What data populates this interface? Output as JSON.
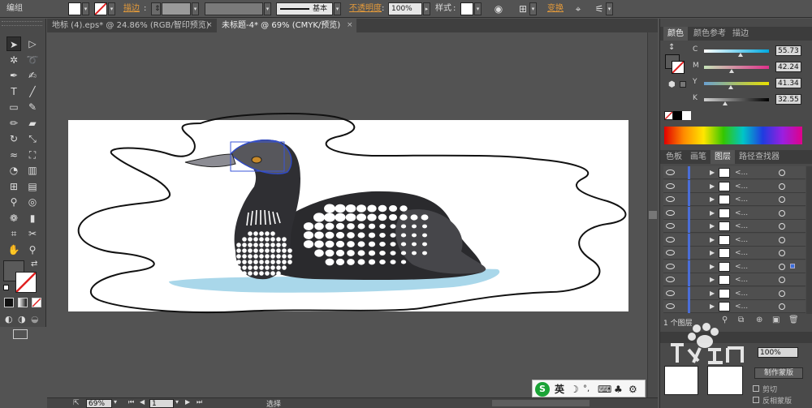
{
  "control_bar": {
    "mode_label": "编组",
    "stroke_label": "描边",
    "stroke_style": "基本",
    "opacity_label": "不透明度",
    "opacity_value": "100%",
    "style_label": "样式",
    "transform_label": "变换"
  },
  "tabs": [
    {
      "label": "地标 (4).eps* @ 24.86% (RGB/智印预览)",
      "close": "×"
    },
    {
      "label": "未标题-4* @ 69% (CMYK/预览)",
      "close": "×"
    }
  ],
  "tools": [
    {
      "icon": "selection-arrow-icon",
      "glyph": "➤"
    },
    {
      "icon": "direct-select-icon",
      "glyph": "▷"
    },
    {
      "icon": "magic-wand-icon",
      "glyph": "✲"
    },
    {
      "icon": "lasso-icon",
      "glyph": "➰"
    },
    {
      "icon": "pen-icon",
      "glyph": "✒"
    },
    {
      "icon": "curvature-icon",
      "glyph": "✍"
    },
    {
      "icon": "type-icon",
      "glyph": "T"
    },
    {
      "icon": "line-icon",
      "glyph": "╱"
    },
    {
      "icon": "rectangle-icon",
      "glyph": "▭"
    },
    {
      "icon": "paintbrush-icon",
      "glyph": "✎"
    },
    {
      "icon": "pencil-icon",
      "glyph": "✏"
    },
    {
      "icon": "eraser-icon",
      "glyph": "▰"
    },
    {
      "icon": "rotate-icon",
      "glyph": "↻"
    },
    {
      "icon": "scale-icon",
      "glyph": "⤡"
    },
    {
      "icon": "warp-icon",
      "glyph": "≈"
    },
    {
      "icon": "free-transform-icon",
      "glyph": "⛶"
    },
    {
      "icon": "shape-builder-icon",
      "glyph": "◔"
    },
    {
      "icon": "graph-icon",
      "glyph": "▥"
    },
    {
      "icon": "mesh-icon",
      "glyph": "⊞"
    },
    {
      "icon": "gradient-icon",
      "glyph": "▤"
    },
    {
      "icon": "eyedropper-icon",
      "glyph": "⚲"
    },
    {
      "icon": "blend-icon",
      "glyph": "◎"
    },
    {
      "icon": "symbol-sprayer-icon",
      "glyph": "❁"
    },
    {
      "icon": "column-graph-icon",
      "glyph": "▮"
    },
    {
      "icon": "artboard-icon",
      "glyph": "⌗"
    },
    {
      "icon": "slice-icon",
      "glyph": "✂"
    },
    {
      "icon": "hand-icon",
      "glyph": "✋"
    },
    {
      "icon": "zoom-icon",
      "glyph": "⚲"
    }
  ],
  "color_panel": {
    "tabs": [
      "颜色",
      "颜色参考",
      "描边"
    ],
    "rows": [
      {
        "letter": "C",
        "value": "55.73",
        "thumb": 0.56
      },
      {
        "letter": "M",
        "value": "42.24",
        "thumb": 0.42
      },
      {
        "letter": "Y",
        "value": "41.34",
        "thumb": 0.41
      },
      {
        "letter": "K",
        "value": "32.55",
        "thumb": 0.33
      }
    ]
  },
  "layers_panel": {
    "tabs": [
      "色板",
      "画笔",
      "图层",
      "路径查找器"
    ],
    "row_count": 11,
    "footer": "1 个图层"
  },
  "transparency_panel": {
    "opacity_value": "100%",
    "make_mask": "制作蒙版",
    "clip": "剪切",
    "invert_mask": "反相蒙版"
  },
  "status_bar": {
    "zoom": "69%",
    "page": "1",
    "tool": "选择"
  },
  "ime": {
    "logo": "S",
    "lang": "英"
  }
}
